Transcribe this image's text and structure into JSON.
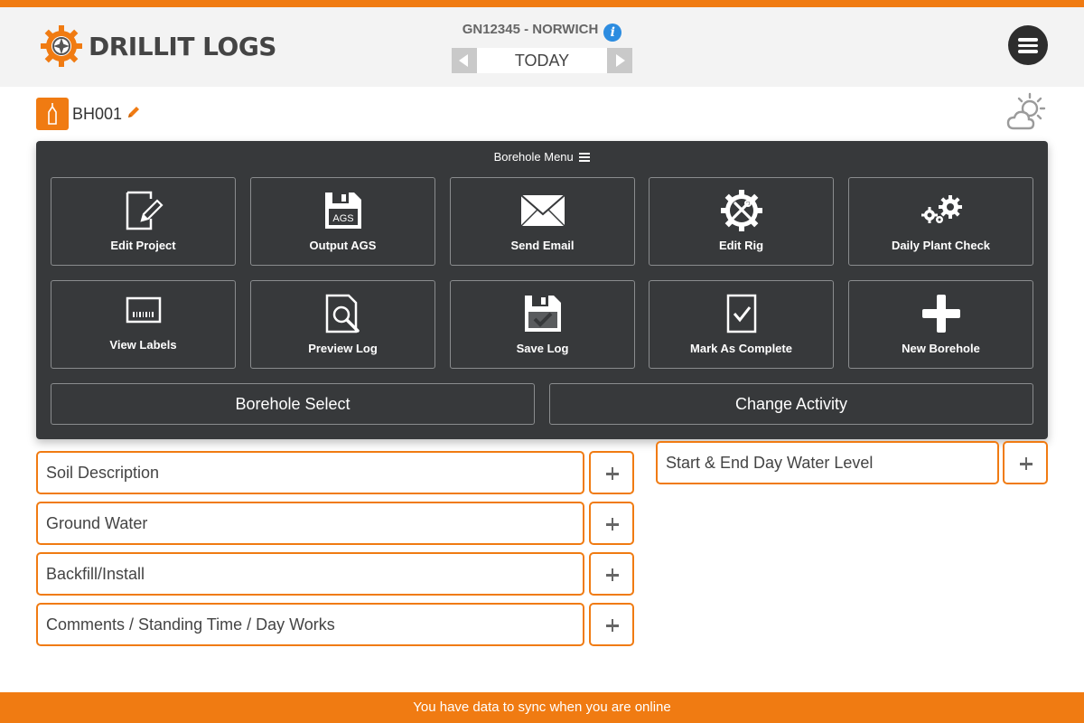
{
  "app": {
    "logo_text": "DRILLIT LOGS"
  },
  "header": {
    "project_title": "GN12345 - NORWICH",
    "date_label": "TODAY"
  },
  "borehole": {
    "name": "BH001"
  },
  "borehole_menu": {
    "title": "Borehole Menu",
    "tiles": [
      {
        "label": "Edit Project",
        "icon": "edit-document-icon"
      },
      {
        "label": "Output AGS",
        "icon": "ags-disk-icon"
      },
      {
        "label": "Send Email",
        "icon": "envelope-icon"
      },
      {
        "label": "Edit Rig",
        "icon": "gear-tools-icon"
      },
      {
        "label": "Daily Plant Check",
        "icon": "gears-icon"
      },
      {
        "label": "View Labels",
        "icon": "barcode-label-icon"
      },
      {
        "label": "Preview Log",
        "icon": "document-search-icon"
      },
      {
        "label": "Save Log",
        "icon": "save-disk-icon"
      },
      {
        "label": "Mark As Complete",
        "icon": "checked-document-icon"
      },
      {
        "label": "New Borehole",
        "icon": "plus-icon"
      }
    ],
    "borehole_select_label": "Borehole Select",
    "change_activity_label": "Change Activity"
  },
  "activities": {
    "left": [
      {
        "label": "Soil Description"
      },
      {
        "label": "Ground Water"
      },
      {
        "label": "Backfill/Install"
      },
      {
        "label": "Comments / Standing Time / Day Works"
      }
    ],
    "right": [
      {
        "label": "Start & End Day Water Level"
      }
    ]
  },
  "footer": {
    "sync_message": "You have data to sync when you are online"
  },
  "colors": {
    "accent": "#f07b12",
    "panel": "#37393b",
    "info": "#2c8ce0"
  }
}
